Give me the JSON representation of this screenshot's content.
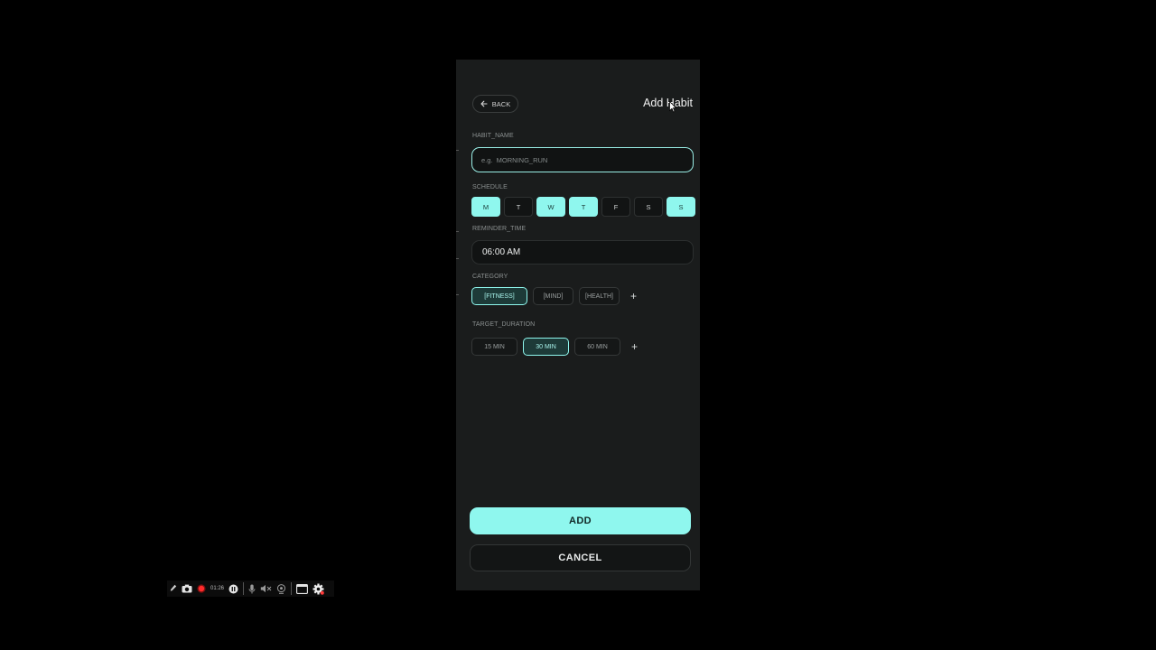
{
  "header": {
    "back_label": "BACK",
    "title": "Add Habit"
  },
  "form": {
    "habit_name": {
      "label": "HABIT_NAME",
      "placeholder": "e.g.  MORNING_RUN",
      "value": ""
    },
    "schedule": {
      "label": "SCHEDULE",
      "days": [
        {
          "label": "M",
          "selected": true
        },
        {
          "label": "T",
          "selected": false
        },
        {
          "label": "W",
          "selected": true
        },
        {
          "label": "T",
          "selected": true
        },
        {
          "label": "F",
          "selected": false
        },
        {
          "label": "S",
          "selected": false
        },
        {
          "label": "S",
          "selected": true
        }
      ]
    },
    "reminder_time": {
      "label": "REMINDER_TIME",
      "value": "06:00 AM"
    },
    "category": {
      "label": "CATEGORY",
      "options": [
        {
          "label": "[FITNESS]",
          "selected": true
        },
        {
          "label": "[MIND]",
          "selected": false
        },
        {
          "label": "[HEALTH]",
          "selected": false
        }
      ],
      "add_symbol": "+"
    },
    "target_duration": {
      "label": "TARGET_DURATION",
      "options": [
        {
          "label": "15 MIN",
          "selected": false
        },
        {
          "label": "30 MIN",
          "selected": true
        },
        {
          "label": "60 MIN",
          "selected": false
        }
      ],
      "add_symbol": "+"
    }
  },
  "actions": {
    "add_label": "ADD",
    "cancel_label": "CANCEL"
  },
  "recorder": {
    "elapsed": "01:26"
  },
  "colors": {
    "accent": "#8ff7ee",
    "panel": "#1a1c1c",
    "background": "#000000"
  }
}
